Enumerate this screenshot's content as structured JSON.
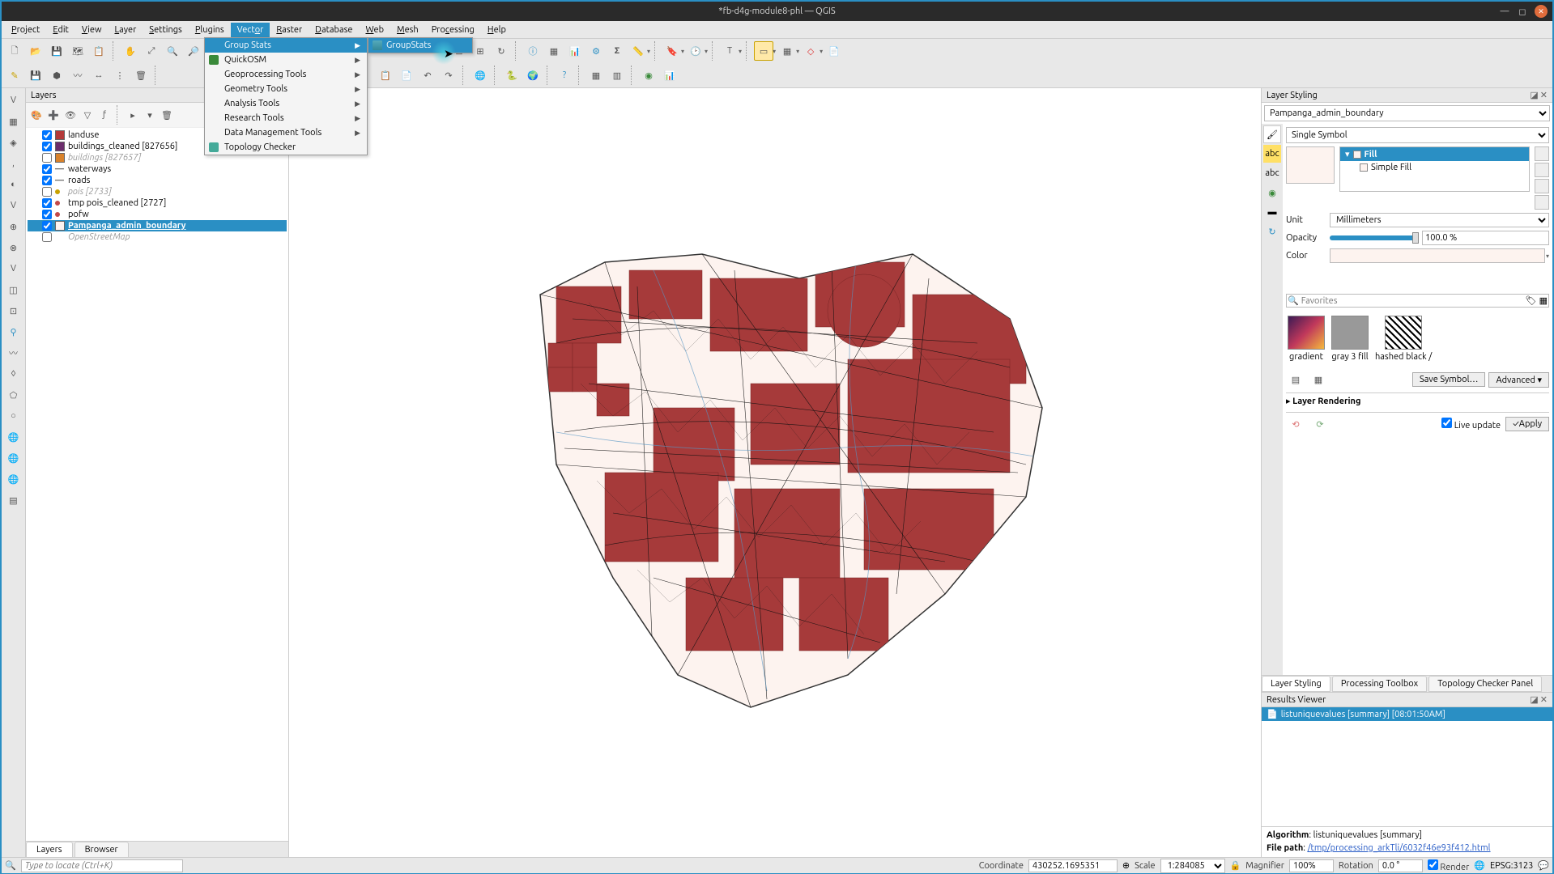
{
  "window": {
    "title": "*fb-d4g-module8-phl — QGIS"
  },
  "menubar": [
    "Project",
    "Edit",
    "View",
    "Layer",
    "Settings",
    "Plugins",
    "Vector",
    "Raster",
    "Database",
    "Web",
    "Mesh",
    "Processing",
    "Help"
  ],
  "vector_menu": {
    "items": [
      {
        "label": "Group Stats",
        "submenu": true,
        "highlighted": true
      },
      {
        "label": "QuickOSM",
        "submenu": true,
        "icon": "osm"
      },
      {
        "label": "Geoprocessing Tools",
        "submenu": true
      },
      {
        "label": "Geometry Tools",
        "submenu": true
      },
      {
        "label": "Analysis Tools",
        "submenu": true
      },
      {
        "label": "Research Tools",
        "submenu": true
      },
      {
        "label": "Data Management Tools",
        "submenu": true
      },
      {
        "label": "Topology Checker",
        "submenu": false,
        "icon": "topo"
      }
    ],
    "submenu_item": "GroupStats"
  },
  "layers_panel": {
    "title": "Layers",
    "items": [
      {
        "checked": true,
        "swatch": "#b33939",
        "label": "landuse"
      },
      {
        "checked": true,
        "swatch": "#6b2c6b",
        "label": "buildings_cleaned [827656]"
      },
      {
        "checked": false,
        "swatch": "#d9822b",
        "label": "buildings [827657]",
        "disabled": true
      },
      {
        "checked": true,
        "swatch": "line",
        "label": "waterways"
      },
      {
        "checked": true,
        "swatch": "line",
        "label": "roads"
      },
      {
        "checked": false,
        "swatch": "dot-y",
        "label": "pois [2733]",
        "disabled": true
      },
      {
        "checked": true,
        "swatch": "dot-r",
        "label": "tmp pois_cleaned [2727]"
      },
      {
        "checked": true,
        "swatch": "dot-r",
        "label": "pofw"
      },
      {
        "checked": true,
        "swatch": "#fdf3ef",
        "label": "Pampanga_admin_boundary",
        "selected": true
      },
      {
        "checked": false,
        "swatch": "none",
        "label": "OpenStreetMap",
        "disabled": true
      }
    ],
    "tabs": [
      "Layers",
      "Browser"
    ],
    "active_tab": "Layers"
  },
  "styling": {
    "panel_title": "Layer Styling",
    "layer_select": "Pampanga_admin_boundary",
    "symbol_type": "Single Symbol",
    "tree": {
      "root": "Fill",
      "child": "Simple Fill"
    },
    "unit_label": "Unit",
    "unit_value": "Millimeters",
    "opacity_label": "Opacity",
    "opacity_value": "100.0 %",
    "color_label": "Color",
    "search_placeholder": "Favorites",
    "swatches": [
      {
        "name": "gradient",
        "style": "gradient"
      },
      {
        "name": "gray 3 fill",
        "style": "gray"
      },
      {
        "name": "hashed black /",
        "style": "hatch"
      }
    ],
    "save_symbol": "Save Symbol…",
    "advanced": "Advanced",
    "layer_rendering": "Layer Rendering",
    "live_update": "Live update",
    "apply": "Apply",
    "tabs": [
      "Layer Styling",
      "Processing Toolbox",
      "Topology Checker Panel"
    ],
    "active_tab": "Layer Styling"
  },
  "results": {
    "title": "Results Viewer",
    "item": "listuniquevalues [summary] [08:01:50AM]",
    "algorithm_label": "Algorithm",
    "algorithm": "listuniquevalues [summary]",
    "filepath_label": "File path",
    "filepath": "/tmp/processing_arkTli/6032f46e93f412.html"
  },
  "statusbar": {
    "locator_placeholder": "Type to locate (Ctrl+K)",
    "coord_label": "Coordinate",
    "coord": "430252.1695351",
    "scale_label": "Scale",
    "scale": "1:284085",
    "magnifier_label": "Magnifier",
    "magnifier": "100%",
    "rotation_label": "Rotation",
    "rotation": "0.0 °",
    "render": "Render",
    "crs": "EPSG:3123"
  }
}
